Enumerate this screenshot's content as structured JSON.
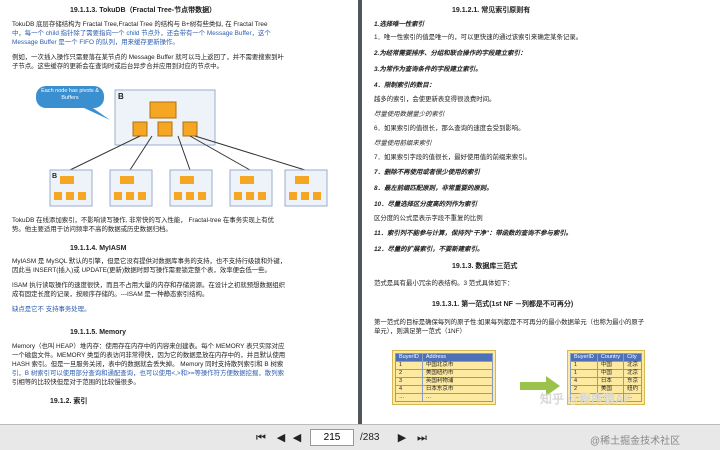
{
  "left": {
    "heading1": "19.1.1.3.   TokuDB（Fractal Tree-节点带数据）",
    "p1a": "TokuDB 底层存储结构为 Fractal Tree,Fractal Tree 的结构与 B+树有些类似, 在 Fractal Tree",
    "p1b": "中，每一个 child 指针除了需要指向一个 child 节点外，还会带有一个 Message Buffer，这个",
    "p1c": "Message Buffer 是一个 FIFO 的队列，用来缓存更新操作。",
    "p2a": "例如，一次插入操作只需要落在某节点的 Message Buffer 就可以马上返回了，并不需要搜索到叶",
    "p2b": "子节点。这些缓存的更新会在查询时或后台异步合并应用到对应的节点中。",
    "bubble": "Each node has pivots & Buffers",
    "rootLabel": "B",
    "leafLabel": "B",
    "p3a": "TokuDB 在线添加索引，不影响读写操作, 非常快的写入性能， Fractal-tree 在事务实现上有优",
    "p3b": "势。他主要适用于访问频率不高的数据或历史数据归档。",
    "heading2": "19.1.1.4.   MyIASM",
    "p4a": "MyIASM 是 MySQL 默认的引擎，但是它没有提供对数据库事务的支持，也不支持行级锁和外键，",
    "p4b": "因此当 INSERT(插入)或 UPDATE(更新)数据时即写操作需要锁定整个表，效率便会低一些。",
    "p5a": "ISAM 执行读取操作的速度很快，而且不占用大量的内存和存储资源。在设计之初就预想数据组织",
    "p5b": "成有固定长度的记录，按顺序存储的。---ISAM 是一种静态索引结构。",
    "p6": "缺点是它不 支持事务处理。",
    "heading3": "19.1.1.5.   Memory",
    "p7a": "Memory（也叫 HEAP）堆内存：使用存在内存中的内容来创建表。每个 MEMORY 表只实际对应",
    "p7b": "一个磁盘文件。MEMORY 类型的表访问非常得快，因为它的数据是放在内存中的，并且默认使用",
    "p7c": "HASH 索引。但是一旦服务关闭，表中的数据就会丢失掉。 Memory 同时支持散列索引和 B 树索",
    "p7d": "引，B 树索引可以使用部分查询和通配查询，也可以使用<,>和>=等操作符方便数据挖掘，散列索",
    "p7e": "引相等的比较快但是对于范围的比较慢很多。",
    "heading4": "19.1.2.    索引"
  },
  "right": {
    "heading1": "19.1.2.1.    常见索引原则有",
    "items": [
      "1.选择唯一性索引",
      "1．唯一性索引的值是唯一的，可以更快速的通过该索引来确定某条记录。",
      "2.为经常需要排序、分组和联合操作的字段建立索引：",
      "3.为常作为查询条件的字段建立索引。",
      "4．限制索引的数目：",
      "越多的索引，会使更新表变得很浪费时间。",
      "尽量使用数据量少的索引",
      "6．如果索引的值很长，那么查询的速度会受到影响。",
      "尽量使用前缀来索引",
      "7．如果索引字段的值很长，最好使用值的前缀来索引。",
      "7．删除不再使用或者很少使用的索引",
      "8．最左前缀匹配原则，非常重要的原则。",
      "10．尽量选择区分度高的列作为索引",
      "区分度的公式是表示字段不重复的比例",
      "11．索引列不能参与计算，保持列\"干净\"：带函数的查询不参与索引。",
      "12．尽量的扩展索引，不要新建索引。"
    ],
    "heading2": "19.1.3.    数据库三范式",
    "p1": "范式是具有最小冗余的表结构。3 范式具体如下：",
    "heading3": "19.1.3.1.    第一范式(1st NF －列都是不可再分)",
    "p2a": "第一范式的目标是确保每列的原子性:如果每列都是不可再分的最小数据单元（也称为最小的原子",
    "p2b": "单元），则满足第一范式（1NF）",
    "table1": {
      "headers": [
        "BuyerID",
        "Address"
      ],
      "rows": [
        [
          "1",
          "中国北京市"
        ],
        [
          "2",
          "美国纽约市"
        ],
        [
          "3",
          "英国利物浦"
        ],
        [
          "4",
          "日本东京市"
        ],
        [
          "…",
          "…"
        ]
      ]
    },
    "table2": {
      "headers": [
        "BuyerID",
        "Country",
        "City"
      ],
      "rows": [
        [
          "1",
          "中国",
          "北京"
        ],
        [
          "1",
          "中国",
          "北京"
        ],
        [
          "4",
          "日本",
          "东京"
        ],
        [
          "2",
          "美国",
          "纽约"
        ],
        [
          "…",
          "…",
          "…"
        ]
      ]
    }
  },
  "toolbar": {
    "page": "215",
    "total": "/283",
    "first": "⏮",
    "prev": "◀",
    "next": "▶",
    "last": "⏭"
  },
  "watermark": "知乎 @程序猿AF",
  "watermark2": "@稀土掘金技术社区",
  "colors": {
    "heading_blue": "#2a5db0",
    "table_head": "#4d70b8",
    "bubble": "#3a8fd0",
    "node": "#f5a623"
  }
}
